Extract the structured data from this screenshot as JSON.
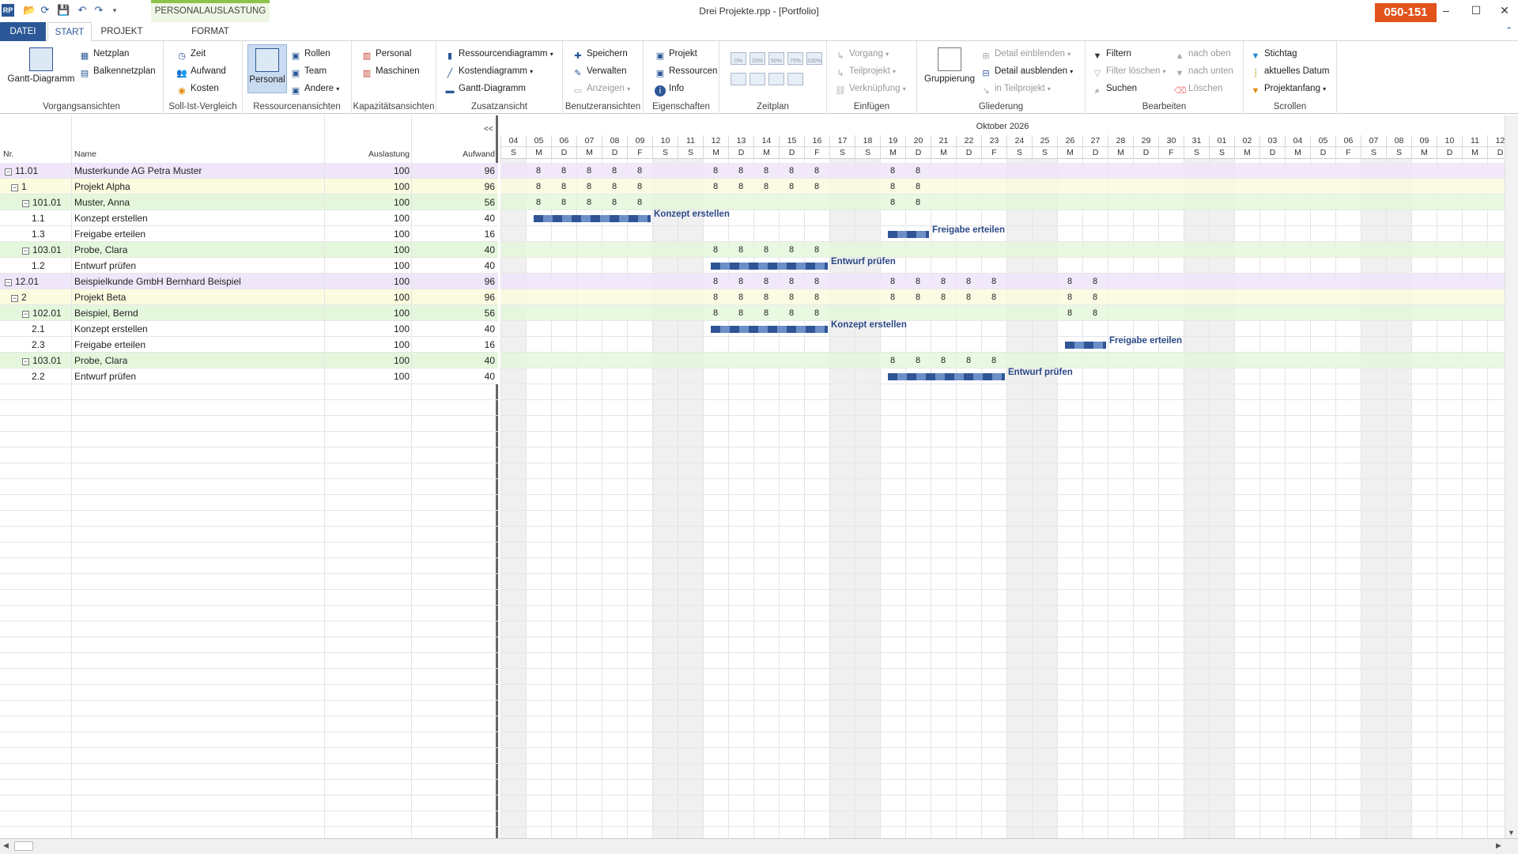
{
  "window": {
    "title": "Drei Projekte.rpp - [Portfolio]",
    "badge": "050-151",
    "min": "–",
    "max": "☐",
    "close": "✕"
  },
  "context_tab": "PERSONALAUSLASTUNG",
  "tabs": {
    "datei": "DATEI",
    "start": "START",
    "projekt": "PROJEKT",
    "format": "FORMAT"
  },
  "ribbon": {
    "vorgangsansichten": {
      "name": "Vorgangsansichten",
      "gantt": "Gantt-Diagramm",
      "netzplan": "Netzplan",
      "balken": "Balkennetzplan"
    },
    "sollist": {
      "name": "Soll-Ist-Vergleich",
      "zeit": "Zeit",
      "aufwand": "Aufwand",
      "kosten": "Kosten"
    },
    "ressourcen": {
      "name": "Ressourcenansichten",
      "personal": "Personal",
      "rollen": "Rollen",
      "team": "Team",
      "andere": "Andere"
    },
    "kapazitaet": {
      "name": "Kapazitätsansichten",
      "personal": "Personal",
      "maschinen": "Maschinen"
    },
    "zusatz": {
      "name": "Zusatzansicht",
      "ressdiag": "Ressourcendiagramm",
      "kostendiag": "Kostendiagramm",
      "gantt": "Gantt-Diagramm"
    },
    "benutzer": {
      "name": "Benutzeransichten",
      "speichern": "Speichern",
      "verwalten": "Verwalten",
      "anzeigen": "Anzeigen"
    },
    "eigenschaften": {
      "name": "Eigenschaften",
      "projekt": "Projekt",
      "ressourcen": "Ressourcen",
      "info": "Info"
    },
    "zeitplan": {
      "name": "Zeitplan",
      "zoom": [
        "0%",
        "25%",
        "50%",
        "75%",
        "100%"
      ]
    },
    "einfuegen": {
      "name": "Einfügen",
      "vorgang": "Vorgang",
      "teilprojekt": "Teilprojekt",
      "verknuepfung": "Verknüpfung"
    },
    "gliederung": {
      "name": "Gliederung",
      "gruppierung": "Gruppierung",
      "detail_ein": "Detail einblenden",
      "detail_aus": "Detail ausblenden",
      "in_teil": "in Teilprojekt"
    },
    "bearbeiten": {
      "name": "Bearbeiten",
      "filtern": "Filtern",
      "filter_loeschen": "Filter löschen",
      "suchen": "Suchen",
      "nach_oben": "nach oben",
      "nach_unten": "nach unten",
      "loeschen": "Löschen"
    },
    "scrollen": {
      "name": "Scrollen",
      "stichtag": "Stichtag",
      "aktuelles": "aktuelles Datum",
      "projektanfang": "Projektanfang"
    }
  },
  "grid": {
    "collapse": "<<",
    "headers": {
      "nr": "Nr.",
      "name": "Name",
      "auslastung": "Auslastung",
      "aufwand": "Aufwand"
    },
    "rows": [
      {
        "nr": "11.01",
        "name": "Musterkunde AG Petra Muster",
        "auslastung": "100",
        "aufwand": "96",
        "level": 0,
        "exp": true,
        "color": "#efe6fa"
      },
      {
        "nr": "1",
        "name": "Projekt Alpha",
        "auslastung": "100",
        "aufwand": "96",
        "level": 1,
        "exp": true,
        "color": "#fbfbe0"
      },
      {
        "nr": "101.01",
        "name": "Muster, Anna",
        "auslastung": "100",
        "aufwand": "56",
        "level": 2,
        "exp": true,
        "color": "#e4f7dc"
      },
      {
        "nr": "1.1",
        "name": "Konzept erstellen",
        "auslastung": "100",
        "aufwand": "40",
        "level": 3,
        "exp": false,
        "color": "#ffffff"
      },
      {
        "nr": "1.3",
        "name": "Freigabe erteilen",
        "auslastung": "100",
        "aufwand": "16",
        "level": 3,
        "exp": false,
        "color": "#ffffff"
      },
      {
        "nr": "103.01",
        "name": "Probe, Clara",
        "auslastung": "100",
        "aufwand": "40",
        "level": 2,
        "exp": true,
        "color": "#e4f7dc"
      },
      {
        "nr": "1.2",
        "name": "Entwurf prüfen",
        "auslastung": "100",
        "aufwand": "40",
        "level": 3,
        "exp": false,
        "color": "#ffffff"
      },
      {
        "nr": "12.01",
        "name": "Beispielkunde GmbH Bernhard Beispiel",
        "auslastung": "100",
        "aufwand": "96",
        "level": 0,
        "exp": true,
        "color": "#efe6fa"
      },
      {
        "nr": "2",
        "name": "Projekt Beta",
        "auslastung": "100",
        "aufwand": "96",
        "level": 1,
        "exp": true,
        "color": "#fbfbe0"
      },
      {
        "nr": "102.01",
        "name": "Beispiel, Bernd",
        "auslastung": "100",
        "aufwand": "56",
        "level": 2,
        "exp": true,
        "color": "#e4f7dc"
      },
      {
        "nr": "2.1",
        "name": "Konzept erstellen",
        "auslastung": "100",
        "aufwand": "40",
        "level": 3,
        "exp": false,
        "color": "#ffffff"
      },
      {
        "nr": "2.3",
        "name": "Freigabe erteilen",
        "auslastung": "100",
        "aufwand": "16",
        "level": 3,
        "exp": false,
        "color": "#ffffff"
      },
      {
        "nr": "103.01",
        "name": "Probe, Clara",
        "auslastung": "100",
        "aufwand": "40",
        "level": 2,
        "exp": true,
        "color": "#e4f7dc"
      },
      {
        "nr": "2.2",
        "name": "Entwurf prüfen",
        "auslastung": "100",
        "aufwand": "40",
        "level": 3,
        "exp": false,
        "color": "#ffffff"
      }
    ]
  },
  "gantt": {
    "month": "Oktober 2026",
    "days": [
      "04",
      "05",
      "06",
      "07",
      "08",
      "09",
      "10",
      "11",
      "12",
      "13",
      "14",
      "15",
      "16",
      "17",
      "18",
      "19",
      "20",
      "21",
      "22",
      "23",
      "24",
      "25",
      "26",
      "27",
      "28",
      "29",
      "30",
      "31",
      "01",
      "02",
      "03",
      "04",
      "05",
      "06",
      "07",
      "08",
      "09",
      "10",
      "11",
      "12"
    ],
    "weekdays": [
      "S",
      "M",
      "D",
      "M",
      "D",
      "F",
      "S",
      "S",
      "M",
      "D",
      "M",
      "D",
      "F",
      "S",
      "S",
      "M",
      "D",
      "M",
      "D",
      "F",
      "S",
      "S",
      "M",
      "D",
      "M",
      "D",
      "F",
      "S",
      "S",
      "M",
      "D",
      "M",
      "D",
      "F",
      "S",
      "S",
      "M",
      "D",
      "M",
      "D"
    ],
    "weekend_idx": [
      0,
      6,
      7,
      13,
      14,
      20,
      21,
      27,
      28,
      34,
      35
    ],
    "hours": {
      "0": {
        "cols": [
          1,
          2,
          3,
          4,
          5,
          8,
          9,
          10,
          11,
          12,
          15,
          16
        ],
        "val": "8"
      },
      "1": {
        "cols": [
          1,
          2,
          3,
          4,
          5,
          8,
          9,
          10,
          11,
          12,
          15,
          16
        ],
        "val": "8"
      },
      "2": {
        "cols": [
          1,
          2,
          3,
          4,
          5,
          15,
          16
        ],
        "val": "8"
      },
      "5": {
        "cols": [
          8,
          9,
          10,
          11,
          12
        ],
        "val": "8"
      },
      "7": {
        "cols": [
          8,
          9,
          10,
          11,
          12,
          15,
          16,
          17,
          18,
          19,
          22,
          23
        ],
        "val": "8"
      },
      "8": {
        "cols": [
          8,
          9,
          10,
          11,
          12,
          15,
          16,
          17,
          18,
          19,
          22,
          23
        ],
        "val": "8"
      },
      "9": {
        "cols": [
          8,
          9,
          10,
          11,
          12,
          22,
          23
        ],
        "val": "8"
      },
      "12": {
        "cols": [
          15,
          16,
          17,
          18,
          19
        ],
        "val": "8"
      }
    },
    "bars": [
      {
        "row": 3,
        "start": 1,
        "days": 5,
        "label": "Konzept erstellen"
      },
      {
        "row": 4,
        "start": 15,
        "days": 2,
        "label": "Freigabe erteilen"
      },
      {
        "row": 6,
        "start": 8,
        "days": 5,
        "label": "Entwurf prüfen"
      },
      {
        "row": 10,
        "start": 8,
        "days": 5,
        "label": "Konzept erstellen"
      },
      {
        "row": 11,
        "start": 22,
        "days": 2,
        "label": "Freigabe erteilen"
      },
      {
        "row": 13,
        "start": 15,
        "days": 5,
        "label": "Entwurf prüfen"
      }
    ]
  }
}
